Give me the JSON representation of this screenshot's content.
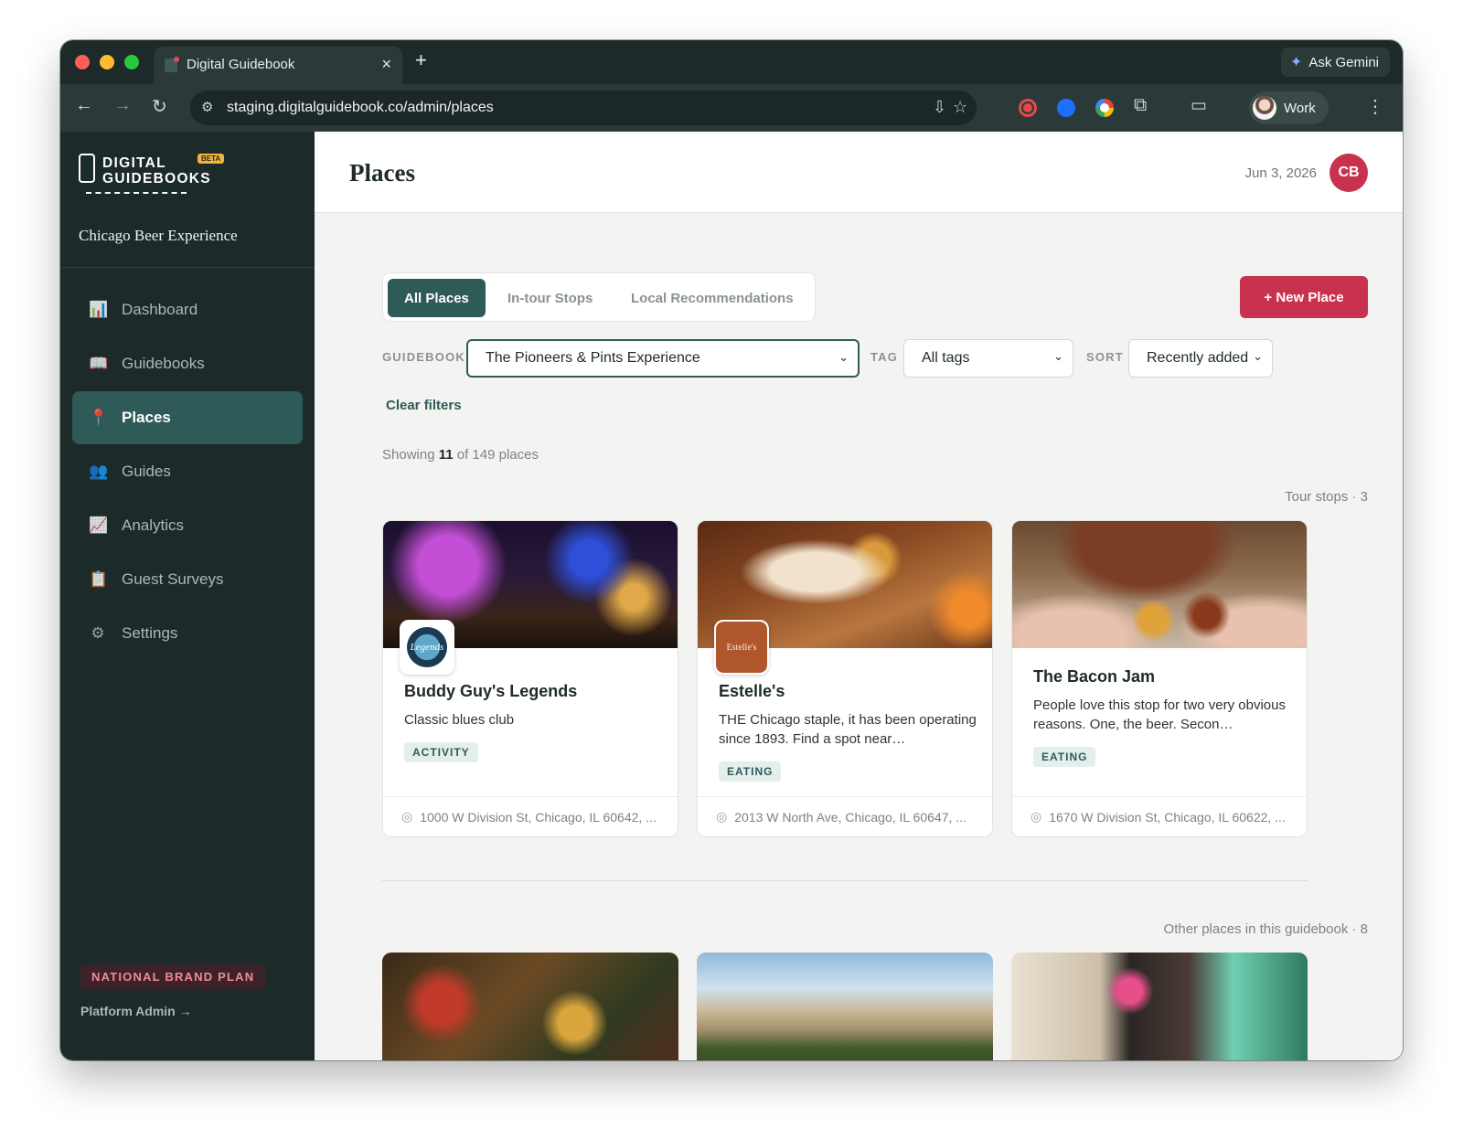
{
  "browser": {
    "tab_title": "Digital Guidebook",
    "new_tab": "+",
    "tab_close": "×",
    "gemini_label": "Ask Gemini",
    "url": "staging.digitalguidebook.co/admin/places",
    "profile_label": "Work"
  },
  "sidebar": {
    "logo_line1": "DIGITAL",
    "logo_line2": "GUIDEBOOKS",
    "logo_beta": "BETA",
    "org_name": "Chicago Beer Experience",
    "items": [
      {
        "label": "Dashboard",
        "icon": "bar-chart-icon"
      },
      {
        "label": "Guidebooks",
        "icon": "book-icon"
      },
      {
        "label": "Places",
        "icon": "pin-icon",
        "active": true
      },
      {
        "label": "Guides",
        "icon": "people-icon"
      },
      {
        "label": "Analytics",
        "icon": "trend-icon"
      },
      {
        "label": "Guest Surveys",
        "icon": "clipboard-icon"
      },
      {
        "label": "Settings",
        "icon": "gear-icon"
      }
    ],
    "plan_badge": "NATIONAL BRAND PLAN",
    "platform_admin": "Platform Admin →"
  },
  "header": {
    "title": "Places",
    "date": "Jun 3, 2026",
    "avatar_initials": "CB"
  },
  "tabs": [
    {
      "label": "All Places",
      "active": true
    },
    {
      "label": "In-tour Stops"
    },
    {
      "label": "Local Recommendations"
    }
  ],
  "new_place_label": "+ New Place",
  "filters": {
    "guidebook_label": "GUIDEBOOK",
    "guidebook_value": "The Pioneers & Pints Experience",
    "tag_label": "TAG",
    "tag_value": "All tags",
    "sort_label": "SORT",
    "sort_value": "Recently added",
    "clear_label": "Clear filters"
  },
  "showing": {
    "prefix": "Showing",
    "count": "11",
    "suffix": "of 149 places"
  },
  "tour_stops_label": "Tour stops · 3",
  "other_places_label": "Other places in this guidebook · 8",
  "cards": [
    {
      "name": "Buddy Guy's Legends",
      "description": "Classic blues club",
      "tag": "ACTIVITY",
      "address": "1000 W Division St, Chicago, IL 60642, ..."
    },
    {
      "name": "Estelle's",
      "description": "THE Chicago staple, it has been operating since 1893. Find a spot near…",
      "tag": "EATING",
      "address": "2013 W North Ave, Chicago, IL 60647, ..."
    },
    {
      "name": "The Bacon Jam",
      "description": "People love this stop for two very obvious reasons. One, the beer. Secon…",
      "tag": "EATING",
      "address": "1670 W Division St, Chicago, IL 60622, ..."
    }
  ],
  "colors": {
    "primary": "#2e5a58",
    "accent": "#c8324f",
    "sidebar": "#1c2b2a"
  }
}
